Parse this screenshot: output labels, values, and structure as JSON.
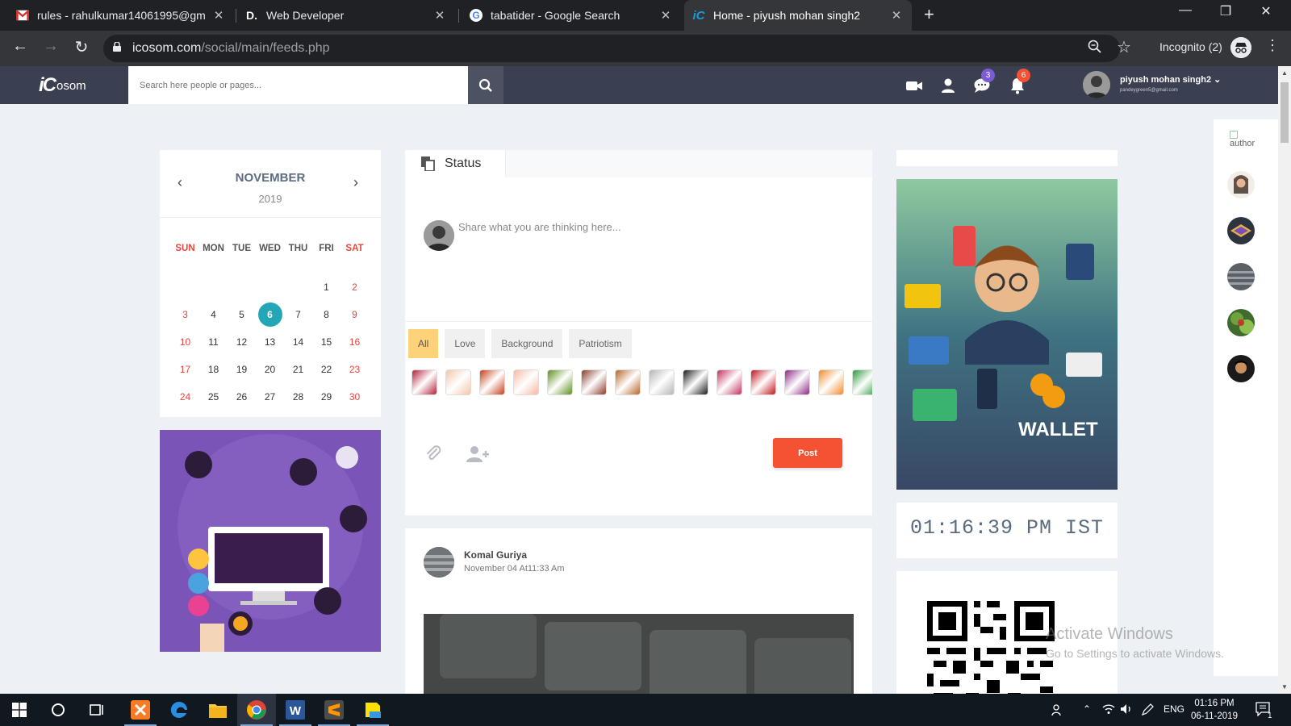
{
  "browser": {
    "tabs": [
      {
        "title": "rules - rahulkumar14061995@gm",
        "icon": "gmail-icon"
      },
      {
        "title": "Web Developer",
        "icon": "dev-icon"
      },
      {
        "title": "tabatider - Google Search",
        "icon": "google-icon"
      },
      {
        "title": "Home - piyush mohan singh2",
        "icon": "icosom-icon",
        "active": true
      }
    ],
    "url_domain": "icosom.com",
    "url_path": "/social/main/feeds.php",
    "incognito_label": "Incognito (2)"
  },
  "site": {
    "logo_ic": "iC",
    "logo_text": "osom",
    "search_placeholder": "Search here people or pages...",
    "messages_badge": "3",
    "notifications_badge": "6",
    "user_name": "piyush mohan singh2",
    "user_email": "pandeygreen5@gmail.com"
  },
  "calendar": {
    "month": "NOVEMBER",
    "year": "2019",
    "weekdays": [
      "SUN",
      "MON",
      "TUE",
      "WED",
      "THU",
      "FRI",
      "SAT"
    ],
    "weeks": [
      [
        "",
        "",
        "",
        "",
        "",
        "1",
        "2"
      ],
      [
        "3",
        "4",
        "5",
        "6",
        "7",
        "8",
        "9"
      ],
      [
        "10",
        "11",
        "12",
        "13",
        "14",
        "15",
        "16"
      ],
      [
        "17",
        "18",
        "19",
        "20",
        "21",
        "22",
        "23"
      ],
      [
        "24",
        "25",
        "26",
        "27",
        "28",
        "29",
        "30"
      ]
    ],
    "today": "6"
  },
  "composer": {
    "tab_label": "Status",
    "placeholder": "Share what you are thinking here...",
    "categories": [
      "All",
      "Love",
      "Background",
      "Patriotism"
    ],
    "active_category": "All",
    "post_label": "Post",
    "swatch_colors": [
      "#b3213a",
      "#f3c6a8",
      "#c8401c",
      "#f6b9a3",
      "#5d8f1f",
      "#8b3a2a",
      "#b8662a",
      "#b5b5b5",
      "#1b1b1b",
      "#c4325e",
      "#c4141c",
      "#8b2a82",
      "#f08c2a",
      "#2a9a3a"
    ]
  },
  "post": {
    "author": "Komal Guriya",
    "time": "November 04 At11:33 Am"
  },
  "sidebar": {
    "wallet_label": "WALLET",
    "clock": "01:16:39 PM IST",
    "rail_author_alt": "author"
  },
  "watermark": {
    "line1": "Activate Windows",
    "line2": "Go to Settings to activate Windows."
  },
  "taskbar": {
    "lang": "ENG",
    "time": "01:16 PM",
    "date": "06-11-2019",
    "notif_count": "1"
  }
}
